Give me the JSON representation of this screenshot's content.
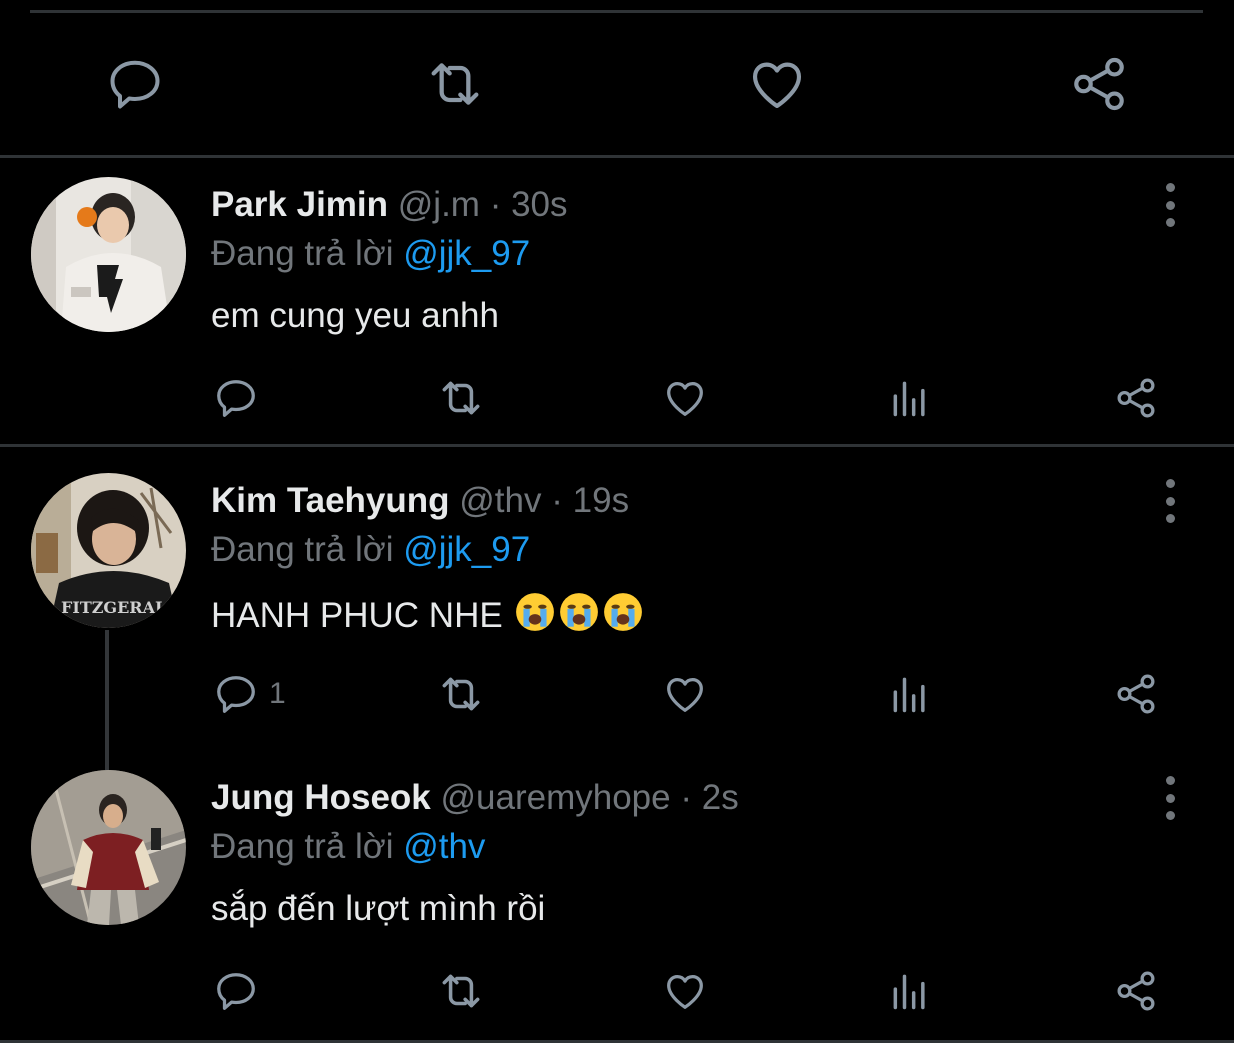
{
  "tweets": [
    {
      "name": "Park Jimin",
      "handle": "@j.m",
      "dot": "·",
      "time": "30s",
      "reply_prefix": "Đang trả lời ",
      "reply_to": "@jjk_97",
      "text": "em cung yeu anhh",
      "reply_count": ""
    },
    {
      "name": "Kim Taehyung",
      "handle": "@thv",
      "dot": "·",
      "time": "19s",
      "reply_prefix": "Đang trả lời ",
      "reply_to": "@jjk_97",
      "text": "HANH PHUC NHE",
      "emojis": [
        "crying-face",
        "crying-face",
        "crying-face"
      ],
      "reply_count": "1"
    },
    {
      "name": "Jung Hoseok",
      "handle": "@uaremyhope",
      "dot": "·",
      "time": "2s",
      "reply_prefix": "Đang trả lời ",
      "reply_to": "@thv",
      "text": "sắp đến lượt mình rồi",
      "reply_count": ""
    }
  ],
  "colors": {
    "background": "#000000",
    "text": "#e7e9ea",
    "muted": "#71767b",
    "mention": "#1d9bf0",
    "separator": "#2f3336"
  },
  "icons": [
    "reply-icon",
    "retweet-icon",
    "like-icon",
    "views-icon",
    "share-icon",
    "more-icon"
  ]
}
